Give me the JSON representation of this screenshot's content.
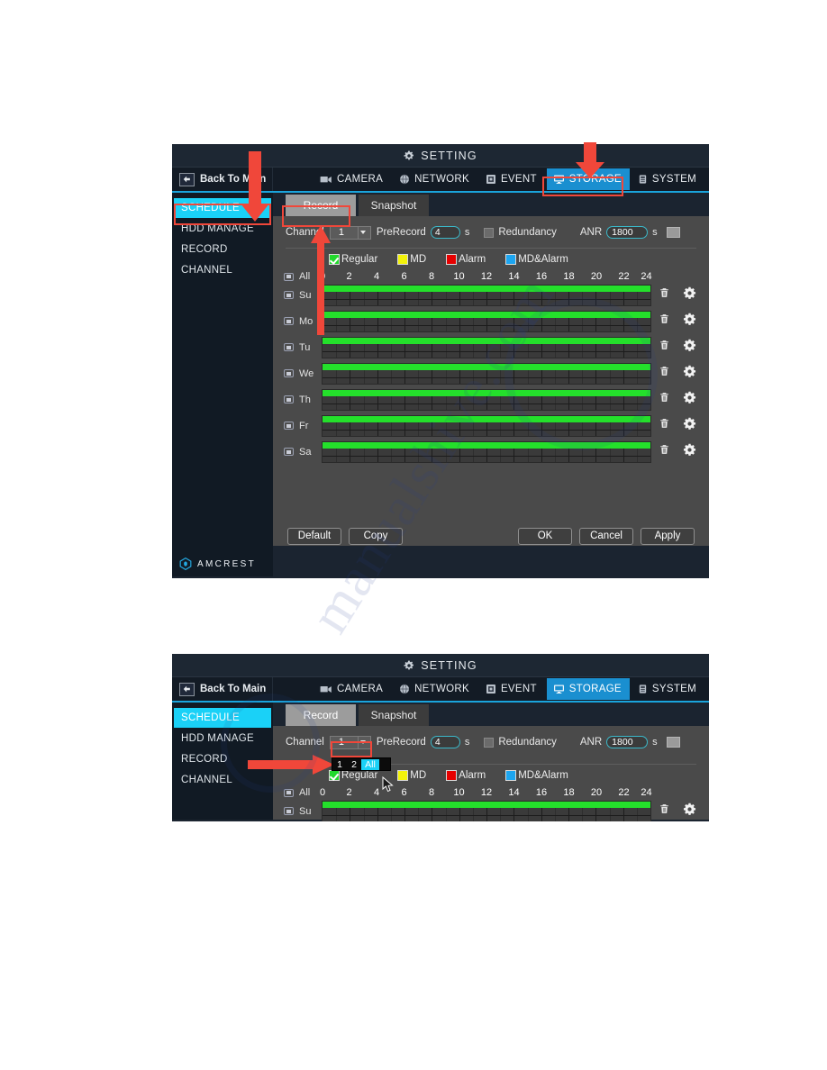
{
  "document": {
    "type": "manual-page-screenshot",
    "brand": "AMCREST"
  },
  "colors": {
    "accent_cyan": "#1ad1f7",
    "tab_blue": "#1a8fd0",
    "highlight_red": "#f0473a",
    "schedule_green": "#24e02b",
    "legend_regular": "#22d92c",
    "legend_md": "#f2f20a",
    "legend_alarm": "#e60000",
    "legend_mdalarm": "#1ca5f0",
    "window_bg": "#1b2430",
    "content_bg": "#4a4a4a"
  },
  "panel1": {
    "titlebar": {
      "icon": "gear-icon",
      "title": "SETTING"
    },
    "nav": {
      "back_label": "Back To Main",
      "back_icon": "back-arrow-icon",
      "tabs": [
        {
          "label": "CAMERA",
          "icon": "camera-icon",
          "active": false
        },
        {
          "label": "NETWORK",
          "icon": "globe-icon",
          "active": false
        },
        {
          "label": "EVENT",
          "icon": "event-icon",
          "active": false
        },
        {
          "label": "STORAGE",
          "icon": "monitor-icon",
          "active": true
        },
        {
          "label": "SYSTEM",
          "icon": "system-icon",
          "active": false
        }
      ]
    },
    "sidebar": {
      "items": [
        {
          "label": "SCHEDULE",
          "active": true
        },
        {
          "label": "HDD MANAGE",
          "active": false
        },
        {
          "label": "RECORD",
          "active": false
        },
        {
          "label": "CHANNEL",
          "active": false
        }
      ],
      "brand": "AMCREST",
      "brand_icon": "amcrest-logo-icon"
    },
    "subtabs": [
      {
        "label": "Record",
        "active": true
      },
      {
        "label": "Snapshot",
        "active": false
      }
    ],
    "form": {
      "channel_label": "Channel",
      "channel_value": "1",
      "prerecord_label": "PreRecord",
      "prerecord_value": "4",
      "prerecord_unit": "s",
      "redundancy_label": "Redundancy",
      "redundancy_checked": false,
      "anr_label": "ANR",
      "anr_value": "1800",
      "anr_unit": "s"
    },
    "legend": [
      {
        "label": "Regular",
        "color": "#22d92c",
        "checked": true
      },
      {
        "label": "MD",
        "color": "#f2f20a",
        "checked": false
      },
      {
        "label": "Alarm",
        "color": "#e60000",
        "checked": false
      },
      {
        "label": "MD&Alarm",
        "color": "#1ca5f0",
        "checked": false
      }
    ],
    "schedule": {
      "all_label": "All",
      "hour_ticks": [
        "0",
        "2",
        "4",
        "6",
        "8",
        "10",
        "12",
        "14",
        "16",
        "18",
        "20",
        "22",
        "24"
      ],
      "rows": [
        {
          "day": "Su",
          "regular_from": 0,
          "regular_to": 24,
          "delete_icon": "trash-icon",
          "settings_icon": "gear-icon"
        },
        {
          "day": "Mo",
          "regular_from": 0,
          "regular_to": 24,
          "delete_icon": "trash-icon",
          "settings_icon": "gear-icon"
        },
        {
          "day": "Tu",
          "regular_from": 0,
          "regular_to": 24,
          "delete_icon": "trash-icon",
          "settings_icon": "gear-icon"
        },
        {
          "day": "We",
          "regular_from": 0,
          "regular_to": 24,
          "delete_icon": "trash-icon",
          "settings_icon": "gear-icon"
        },
        {
          "day": "Th",
          "regular_from": 0,
          "regular_to": 24,
          "delete_icon": "trash-icon",
          "settings_icon": "gear-icon"
        },
        {
          "day": "Fr",
          "regular_from": 0,
          "regular_to": 24,
          "delete_icon": "trash-icon",
          "settings_icon": "gear-icon"
        },
        {
          "day": "Sa",
          "regular_from": 0,
          "regular_to": 24,
          "delete_icon": "trash-icon",
          "settings_icon": "gear-icon"
        }
      ]
    },
    "buttons": {
      "default": "Default",
      "copy": "Copy",
      "ok": "OK",
      "cancel": "Cancel",
      "apply": "Apply"
    }
  },
  "panel2": {
    "titlebar": {
      "icon": "gear-icon",
      "title": "SETTING"
    },
    "nav": {
      "back_label": "Back To Main",
      "back_icon": "back-arrow-icon",
      "tabs": [
        {
          "label": "CAMERA",
          "icon": "camera-icon",
          "active": false
        },
        {
          "label": "NETWORK",
          "icon": "globe-icon",
          "active": false
        },
        {
          "label": "EVENT",
          "icon": "event-icon",
          "active": false
        },
        {
          "label": "STORAGE",
          "icon": "monitor-icon",
          "active": true
        },
        {
          "label": "SYSTEM",
          "icon": "system-icon",
          "active": false
        }
      ]
    },
    "sidebar": {
      "items": [
        {
          "label": "SCHEDULE",
          "active": true
        },
        {
          "label": "HDD MANAGE",
          "active": false
        },
        {
          "label": "RECORD",
          "active": false
        },
        {
          "label": "CHANNEL",
          "active": false
        }
      ]
    },
    "subtabs": [
      {
        "label": "Record",
        "active": true
      },
      {
        "label": "Snapshot",
        "active": false
      }
    ],
    "form": {
      "channel_label": "Channel",
      "channel_value": "1",
      "prerecord_label": "PreRecord",
      "prerecord_value": "4",
      "prerecord_unit": "s",
      "redundancy_label": "Redundancy",
      "redundancy_checked": false,
      "anr_label": "ANR",
      "anr_value": "1800",
      "anr_unit": "s"
    },
    "channel_dropdown": {
      "open": true,
      "options": [
        {
          "label": "1",
          "selected": false
        },
        {
          "label": "2",
          "selected": false
        },
        {
          "label": "All",
          "selected": true
        }
      ]
    },
    "legend": [
      {
        "label": "Regular",
        "color": "#22d92c",
        "checked": true
      },
      {
        "label": "MD",
        "color": "#f2f20a",
        "checked": false
      },
      {
        "label": "Alarm",
        "color": "#e60000",
        "checked": false
      },
      {
        "label": "MD&Alarm",
        "color": "#1ca5f0",
        "checked": false
      }
    ],
    "schedule": {
      "all_label": "All",
      "hour_ticks": [
        "0",
        "2",
        "4",
        "6",
        "8",
        "10",
        "12",
        "14",
        "16",
        "18",
        "20",
        "22",
        "24"
      ],
      "rows": [
        {
          "day": "Su",
          "regular_from": 0,
          "regular_to": 24,
          "delete_icon": "trash-icon",
          "settings_icon": "gear-icon"
        }
      ]
    },
    "cursor": "mouse-pointer-icon"
  },
  "annotations": [
    {
      "name": "arrow-to-schedule",
      "type": "arrow-down",
      "target": "panel1 SCHEDULE sidebar item"
    },
    {
      "name": "arrow-to-storage",
      "type": "arrow-down",
      "target": "panel1 STORAGE tab"
    },
    {
      "name": "arrow-to-record-tab",
      "type": "arrow-up",
      "target": "panel1 Record subtab"
    },
    {
      "name": "arrow-to-dropdown",
      "type": "arrow-right",
      "target": "panel2 Channel dropdown list"
    },
    {
      "name": "highlight-storage",
      "type": "rect",
      "target": "panel1 STORAGE tab"
    },
    {
      "name": "highlight-schedule",
      "type": "rect",
      "target": "panel1 SCHEDULE sidebar item"
    },
    {
      "name": "highlight-record",
      "type": "rect",
      "target": "panel1 Record subtab"
    },
    {
      "name": "highlight-channel",
      "type": "rect",
      "target": "panel2 Channel select"
    }
  ]
}
